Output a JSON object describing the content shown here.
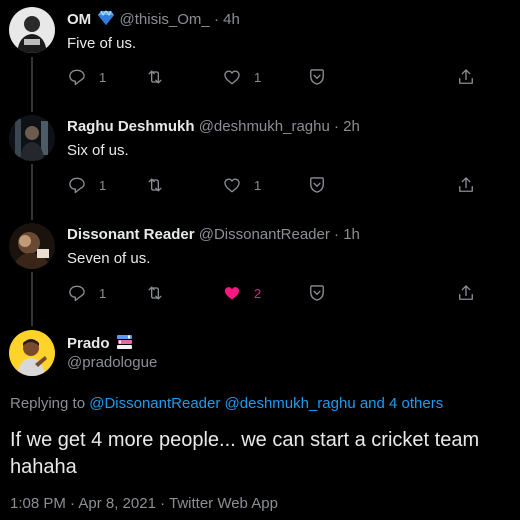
{
  "replies": [
    {
      "name": "OM",
      "handle": "@thisis_Om_",
      "time": "4h",
      "badge": "gem-emoji",
      "text": "Five of us.",
      "replies": "1",
      "retweets": "",
      "likes": "1",
      "liked": false
    },
    {
      "name": "Raghu Deshmukh",
      "handle": "@deshmukh_raghu",
      "time": "2h",
      "text": "Six of us.",
      "replies": "1",
      "retweets": "",
      "likes": "1",
      "liked": false
    },
    {
      "name": "Dissonant Reader",
      "handle": "@DissonantReader",
      "time": "1h",
      "text": "Seven of us.",
      "replies": "1",
      "retweets": "",
      "likes": "2",
      "liked": true
    }
  ],
  "main": {
    "name": "Prado",
    "badge": "books-emoji",
    "handle": "@pradologue",
    "replying_prefix": "Replying to",
    "replying_to_1": "@DissonantReader",
    "replying_to_2": "@deshmukh_raghu",
    "replying_suffix": "and 4 others",
    "text": "If we get 4 more people... we can start a cricket team hahaha",
    "timestamp": "1:08 PM · Apr 8, 2021 · Twitter Web App"
  },
  "colors": {
    "background": "#000000",
    "link": "#1d9bf0",
    "like": "#f91880",
    "muted": "#8b8f94"
  }
}
